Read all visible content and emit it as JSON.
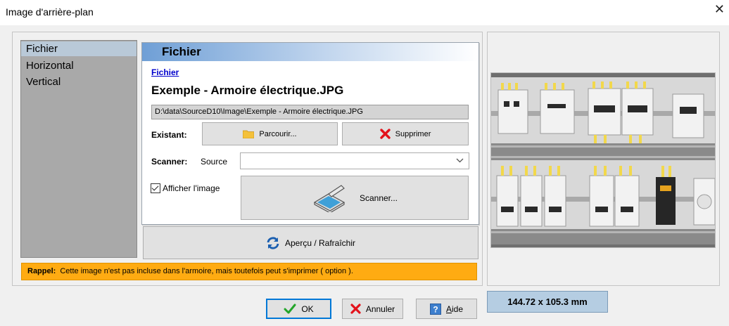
{
  "window": {
    "title": "Image d'arrière-plan",
    "close_glyph": "✕"
  },
  "nav": {
    "items": [
      {
        "label": "Fichier",
        "selected": true
      },
      {
        "label": "Horizontal",
        "selected": false
      },
      {
        "label": "Vertical",
        "selected": false
      }
    ]
  },
  "section": {
    "header": "Fichier",
    "link": "Fichier",
    "file_name": "Exemple - Armoire électrique.JPG",
    "path": "D:\\data\\SourceD10\\Image\\Exemple - Armoire électrique.JPG"
  },
  "existing": {
    "label": "Existant:",
    "browse_label": "Parcourir...",
    "delete_label": "Supprimer"
  },
  "scanner": {
    "label": "Scanner:",
    "source_label": "Source",
    "source_value": "",
    "show_image_label": "Afficher l'image",
    "show_image_checked": true,
    "scan_label": "Scanner..."
  },
  "preview_button": "Aperçu / Rafraîchir",
  "reminder": {
    "prefix": "Rappel:",
    "text": "Cette image n'est pas incluse dans l'armoire, mais toutefois peut s'imprimer ( option )."
  },
  "size_display": "144.72 x 105.3 mm",
  "buttons": {
    "ok": "OK",
    "cancel": "Annuler",
    "help_prefix": "A",
    "help_rest": "ide"
  },
  "colors": {
    "reminder_bg": "#ffab12",
    "size_bg": "#b5cde2",
    "nav_bg": "#a9a9a9",
    "accent": "#0078d7"
  },
  "icons": {
    "browse": "folder-icon",
    "delete": "red-x-icon",
    "scan": "scanner-icon",
    "preview": "refresh-icon",
    "ok": "green-check-icon",
    "cancel": "red-x-icon",
    "help": "help-icon"
  }
}
